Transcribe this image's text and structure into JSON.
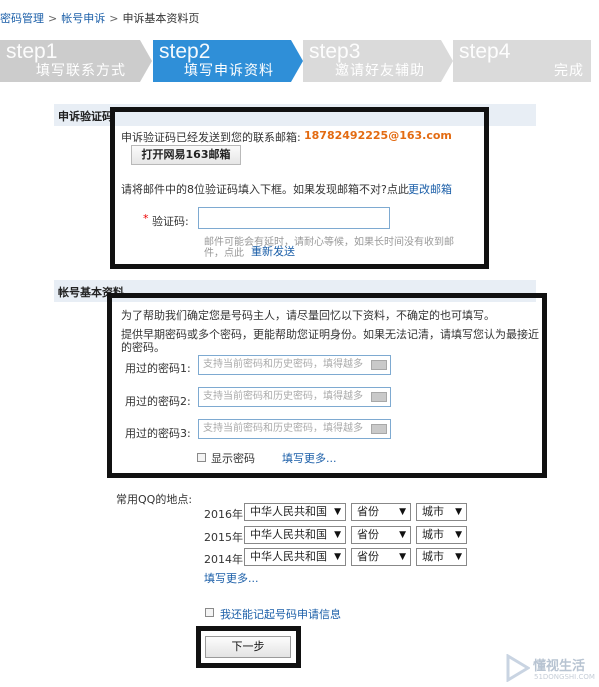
{
  "breadcrumb": {
    "item1": "密码管理",
    "item2": "帐号申诉",
    "current": "申诉基本资料页",
    "sep": ">"
  },
  "steps": [
    {
      "num": "step1",
      "label": "填写联系方式",
      "state": "done"
    },
    {
      "num": "step2",
      "label": "填写申诉资料",
      "state": "active"
    },
    {
      "num": "step3",
      "label": "邀请好友辅助",
      "state": "pending"
    },
    {
      "num": "step4",
      "label": "完成",
      "state": "pending"
    }
  ],
  "verify": {
    "section_title": "申诉验证码",
    "sent_text": "申诉验证码已经发送到您的联系邮箱:",
    "email": "18782492225@163.com",
    "open_button": "打开网易163邮箱",
    "instruction": "请将邮件中的8位验证码填入下框。如果发现邮箱不对?点此",
    "change_link": "更改邮箱",
    "required_mark": "*",
    "code_label": "验证码:",
    "code_value": "",
    "delay_note_1": "邮件可能会有延时，请耐心等候，如果长时间没有收到邮",
    "delay_note_2": "件，点此",
    "resend_link": "重新发送"
  },
  "account": {
    "section_title": "帐号基本资料",
    "intro": "为了帮助我们确定您是号码主人，请尽量回忆以下资料，不确定的也可填写。",
    "pw_intro_1": "提供早期密码或多个密码，更能帮助您证明身份。如果无法记清，请填写您认为最接近",
    "pw_intro_2": "的密码。",
    "pw_fields": [
      {
        "label": "用过的密码1:",
        "placeholder": "支持当前密码和历史密码，填得越多"
      },
      {
        "label": "用过的密码2:",
        "placeholder": "支持当前密码和历史密码，填得越多"
      },
      {
        "label": "用过的密码3:",
        "placeholder": "支持当前密码和历史密码，填得越多"
      }
    ],
    "show_password": "显示密码",
    "more_link": "填写更多...",
    "location_label": "常用QQ的地点:",
    "locations": [
      {
        "year": "2016年",
        "country": "中华人民共和国",
        "province": "省份",
        "city": "城市"
      },
      {
        "year": "2015年",
        "country": "中华人民共和国",
        "province": "省份",
        "city": "城市"
      },
      {
        "year": "2014年",
        "country": "中华人民共和国",
        "province": "省份",
        "city": "城市"
      }
    ],
    "location_more_link": "填写更多...",
    "recall_checkbox": "我还能记起号码申请信息",
    "next_button": "下一步"
  },
  "watermark": {
    "line1": "懂视生活",
    "line2": "51DONGSHI.COM"
  },
  "colors": {
    "step_active": "#2f8fd8",
    "step_pending": "#dcdcdc",
    "step_done": "#c8c8c8",
    "link": "#1a5ea8",
    "email": "#e36b12",
    "frame": "#111111"
  }
}
